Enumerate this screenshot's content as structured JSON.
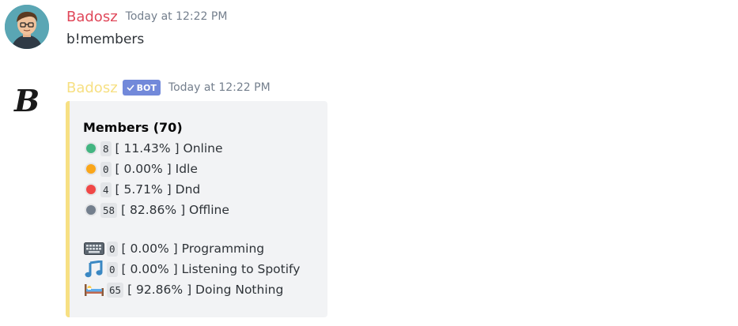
{
  "messages": [
    {
      "author": "Badosz",
      "author_color": "#e0485a",
      "timestamp": "Today at 12:22 PM",
      "content": "b!members"
    },
    {
      "author": "Badosz",
      "author_color": "#f7e083",
      "bot_tag": "BOT",
      "timestamp": "Today at 12:22 PM",
      "embed": {
        "accent_color": "#f7e083",
        "title": "Members (70)",
        "statuses": [
          {
            "icon": "online-status-icon",
            "color": "#43b581",
            "count": "8",
            "text": "[ 11.43% ] Online"
          },
          {
            "icon": "idle-status-icon",
            "color": "#faa61a",
            "count": "0",
            "text": "[ 0.00% ] Idle"
          },
          {
            "icon": "dnd-status-icon",
            "color": "#f04747",
            "count": "4",
            "text": "[ 5.71% ] Dnd"
          },
          {
            "icon": "offline-status-icon",
            "color": "#747f8d",
            "count": "58",
            "text": "[ 82.86% ] Offline"
          }
        ],
        "activities": [
          {
            "icon": "keyboard-icon",
            "count": "0",
            "text": "[ 0.00% ] Programming"
          },
          {
            "icon": "music-note-icon",
            "count": "0",
            "text": "[ 0.00% ] Listening to Spotify"
          },
          {
            "icon": "bed-icon",
            "count": "65",
            "text": "[ 92.86% ] Doing Nothing"
          }
        ]
      }
    }
  ]
}
